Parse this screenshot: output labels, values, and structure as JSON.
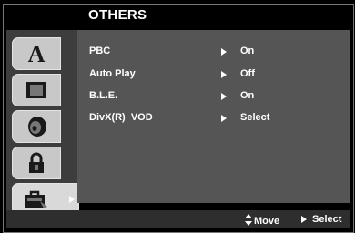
{
  "header": {
    "title": "OTHERS"
  },
  "sidebar": {
    "tabs": [
      {
        "name": "language",
        "icon": "language-a-icon"
      },
      {
        "name": "display",
        "icon": "tv-display-icon"
      },
      {
        "name": "audio",
        "icon": "speaker-icon"
      },
      {
        "name": "lock",
        "icon": "padlock-icon"
      },
      {
        "name": "others",
        "icon": "briefcase-icon",
        "active": true
      }
    ]
  },
  "menu": {
    "items": [
      {
        "label": "PBC",
        "value": "On"
      },
      {
        "label": "Auto Play",
        "value": "Off"
      },
      {
        "label": "B.L.E.",
        "value": "On"
      },
      {
        "label": "DivX(R)  VOD",
        "value": "Select"
      }
    ]
  },
  "footer": {
    "move_label": "Move",
    "select_label": "Select"
  },
  "colors": {
    "panel": "#555555",
    "sidebar": "#3d3d3d",
    "tab": "#c8c8c8",
    "text": "#ffffff"
  }
}
